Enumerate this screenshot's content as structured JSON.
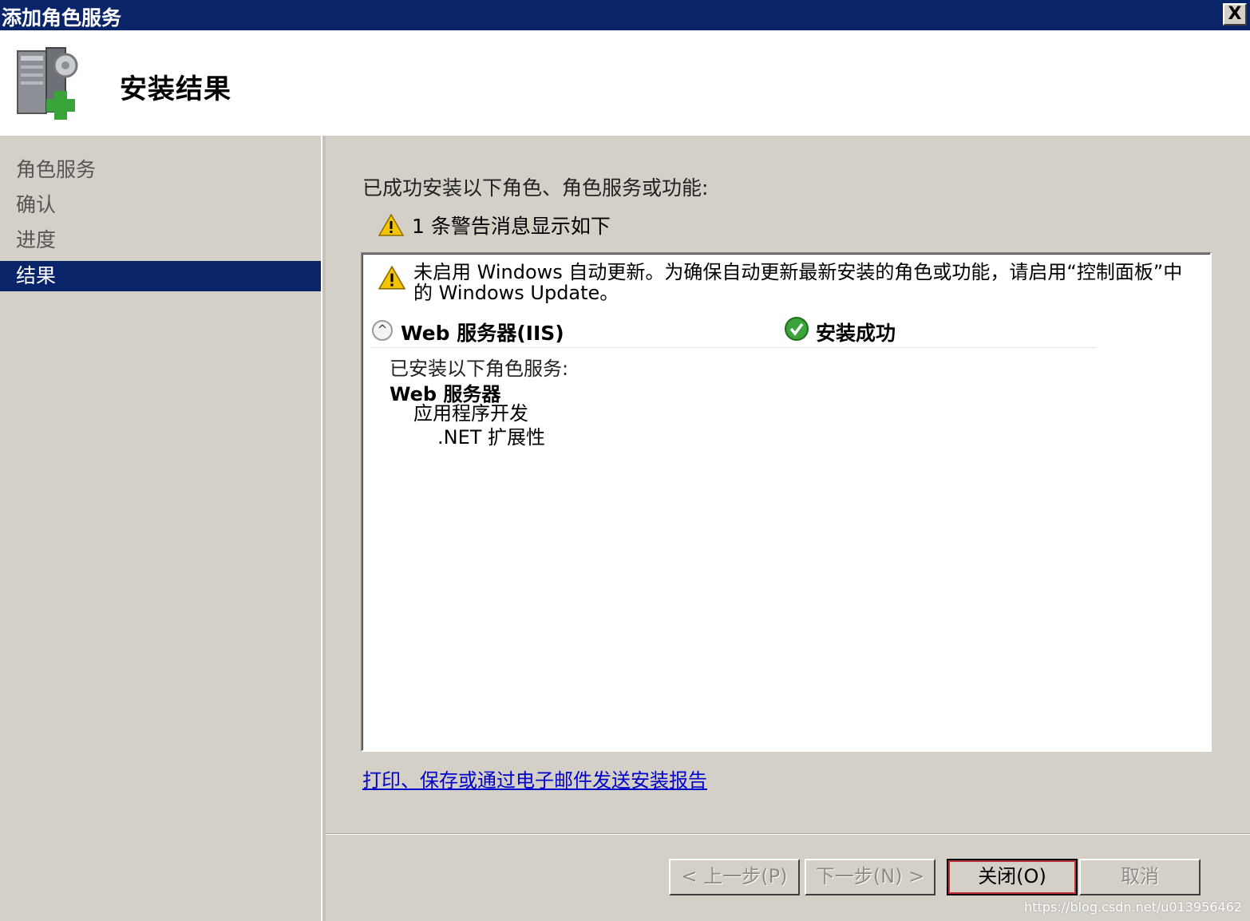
{
  "window": {
    "title": "添加角色服务",
    "close_label": "X"
  },
  "header": {
    "title": "安装结果"
  },
  "sidebar": {
    "items": [
      {
        "label": "角色服务"
      },
      {
        "label": "确认"
      },
      {
        "label": "进度"
      },
      {
        "label": "结果"
      }
    ],
    "active_index": 3
  },
  "main": {
    "summary": "已成功安装以下角色、角色服务或功能:",
    "warning_count_text": "1 条警告消息显示如下",
    "warning_message": "未启用 Windows 自动更新。为确保自动更新最新安装的角色或功能，请启用“控制面板”中的 Windows Update。",
    "role": {
      "name": "Web 服务器(IIS)",
      "status": "安装成功"
    },
    "installed_title": "已安装以下角色服务:",
    "tree": {
      "level1": "Web 服务器",
      "level2": "应用程序开发",
      "level3": ".NET 扩展性"
    },
    "report_link": "打印、保存或通过电子邮件发送安装报告"
  },
  "buttons": {
    "prev": "< 上一步(P)",
    "next": "下一步(N) >",
    "close": "关闭(O)",
    "cancel": "取消"
  },
  "watermark": "https://blog.csdn.net/u013956462",
  "colors": {
    "titlebar": "#0a246a",
    "selection": "#0a246a",
    "dialog_bg": "#d4d0c8",
    "link": "#0000cc",
    "success": "#3aa33a",
    "warning": "#f5c400"
  }
}
